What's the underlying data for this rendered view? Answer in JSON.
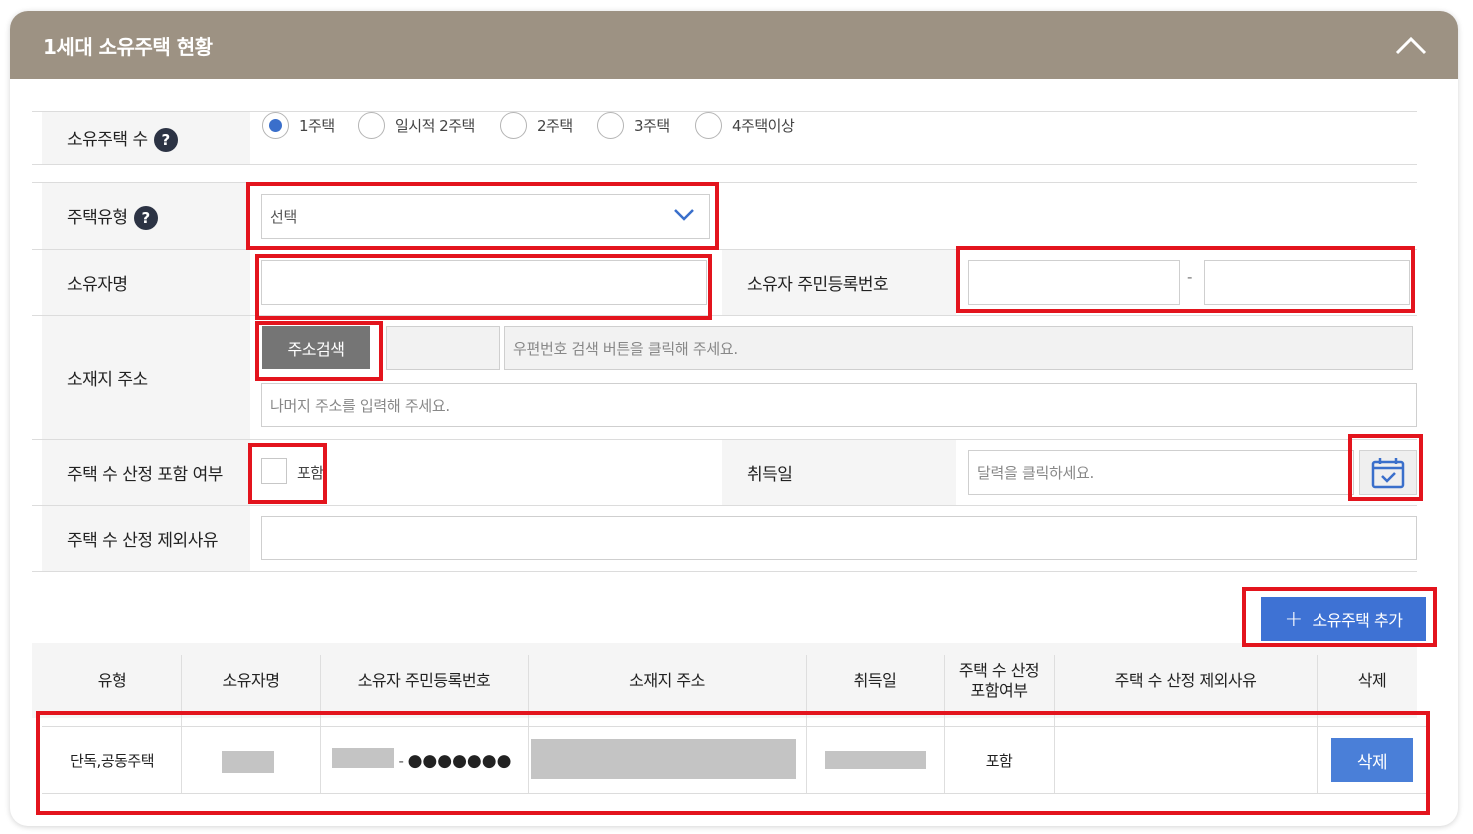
{
  "header": {
    "title": "1세대 소유주택 현황"
  },
  "houses_count": {
    "label": "소유주택 수",
    "help": "?",
    "options": [
      "1주택",
      "일시적 2주택",
      "2주택",
      "3주택",
      "4주택이상"
    ],
    "selected": "1주택"
  },
  "house_type": {
    "label": "주택유형",
    "help": "?",
    "value": "선택"
  },
  "owner_name": {
    "label": "소유자명",
    "value": ""
  },
  "owner_rrn": {
    "label": "소유자 주민등록번호",
    "separator": "-"
  },
  "address": {
    "label": "소재지 주소",
    "search_button": "주소검색",
    "postal_placeholder": "우편번호 검색 버튼을 클릭해 주세요.",
    "detail_placeholder": "나머지 주소를 입력해 주세요."
  },
  "inclusion": {
    "label": "주택 수 산정 포함 여부",
    "checkbox_label": "포함"
  },
  "acquisition": {
    "label": "취득일",
    "placeholder": "달력을 클릭하세요."
  },
  "exclusion_reason": {
    "label": "주택 수 산정 제외사유"
  },
  "add_button": {
    "plus": "+",
    "label": "소유주택 추가"
  },
  "table": {
    "headers": [
      "유형",
      "소유자명",
      "소유자 주민등록번호",
      "소재지 주소",
      "취득일",
      "주택 수 산정\n포함여부",
      "주택 수 산정 제외사유",
      "삭제"
    ],
    "rows": [
      {
        "type": "단독,공동주택",
        "rrn_separator": "-",
        "rrn_masked": "●●●●●●●",
        "included": "포함",
        "exclusion_reason": "",
        "delete": "삭제"
      }
    ]
  },
  "colors": {
    "header_bg": "#9d9283",
    "accent_blue": "#3e72d4",
    "highlight_red": "#e3141d"
  }
}
